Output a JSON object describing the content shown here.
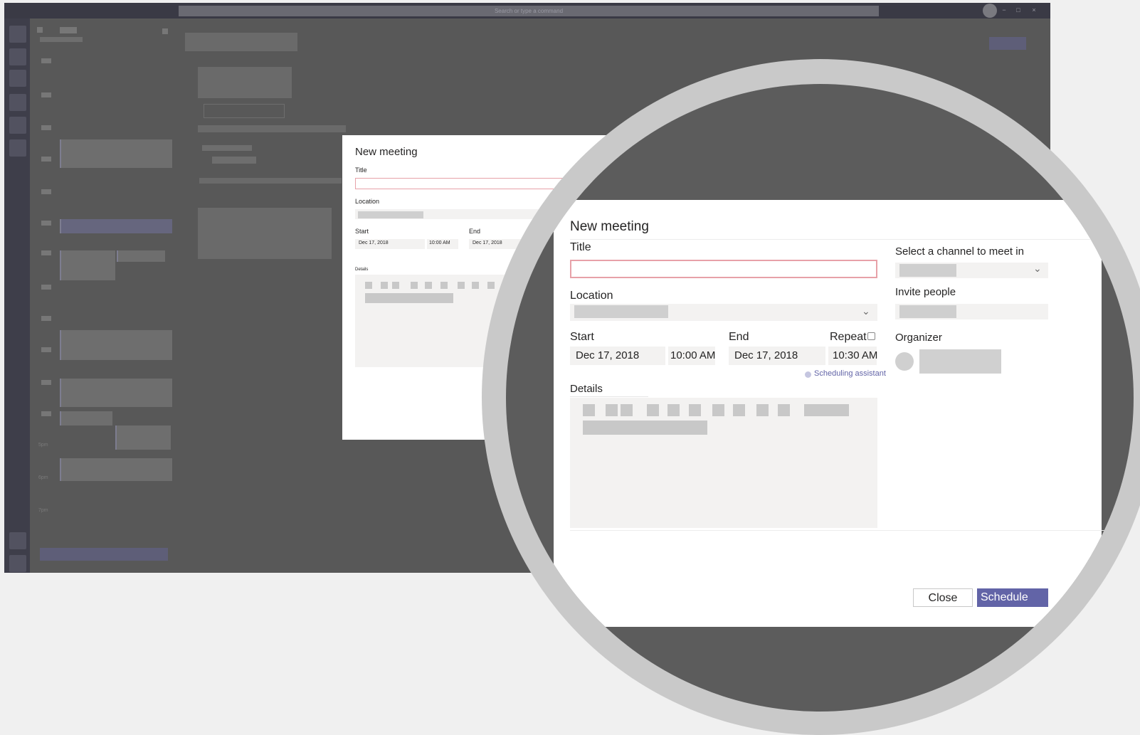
{
  "app": {
    "search_placeholder": "Search or type a command",
    "window_controls": [
      "−",
      "□",
      "×"
    ],
    "time_labels": [
      "5pm",
      "6pm",
      "7pm"
    ]
  },
  "small_dialog": {
    "title": "New meeting",
    "title_label": "Title",
    "location_label": "Location",
    "start_label": "Start",
    "end_label": "End",
    "start_date": "Dec 17, 2018",
    "start_time": "10:00 AM",
    "end_date": "Dec 17, 2018",
    "details_label": "Details"
  },
  "dialog": {
    "heading": "New meeting",
    "title_label": "Title",
    "title_value": "",
    "location_label": "Location",
    "start_label": "Start",
    "start_date": "Dec 17, 2018",
    "start_time": "10:00 AM",
    "end_label": "End",
    "end_date": "Dec 17, 2018",
    "end_time": "10:30 AM",
    "repeat_label": "Repeat",
    "repeat_checked": false,
    "scheduling_assistant": "Scheduling assistant",
    "details_label": "Details",
    "channel_label": "Select a channel to meet in",
    "invite_label": "Invite people",
    "organizer_label": "Organizer",
    "close_button": "Close",
    "schedule_button": "Schedule"
  },
  "colors": {
    "accent": "#6264a7",
    "error_border": "#e7a1a8",
    "field_bg": "#f3f2f1",
    "overlay": "#5c5c5c"
  },
  "icons": [
    "chevron-down-icon",
    "checkbox-icon",
    "scheduling-assistant-icon"
  ]
}
